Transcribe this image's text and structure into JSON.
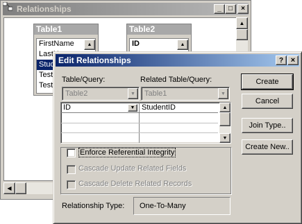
{
  "rel_window": {
    "title": "Relationships",
    "minimize": "_",
    "maximize": "□",
    "close": "×"
  },
  "table1": {
    "title": "Table1",
    "fields": [
      "FirstName",
      "LastN",
      "Stud",
      "Test1",
      "Test2"
    ]
  },
  "table2": {
    "title": "Table2",
    "fields": [
      "ID"
    ]
  },
  "dialog": {
    "title": "Edit Relationships",
    "help": "?",
    "close": "×",
    "table_query_label": "Table/Query:",
    "related_label": "Related Table/Query:",
    "table_query_value": "Table2",
    "related_value": "Table1",
    "grid_rows": [
      {
        "left": "ID",
        "right": "StudentID"
      },
      {
        "left": "",
        "right": ""
      },
      {
        "left": "",
        "right": ""
      },
      {
        "left": "",
        "right": ""
      }
    ],
    "enforce_label": "Enforce Referential Integrity",
    "cascade_update_label": "Cascade Update Related Fields",
    "cascade_delete_label": "Cascade Delete Related Records",
    "rel_type_label": "Relationship Type:",
    "rel_type_value": "One-To-Many",
    "buttons": {
      "create": "Create",
      "cancel": "Cancel",
      "join_type": "Join Type..",
      "create_new": "Create New.."
    }
  }
}
